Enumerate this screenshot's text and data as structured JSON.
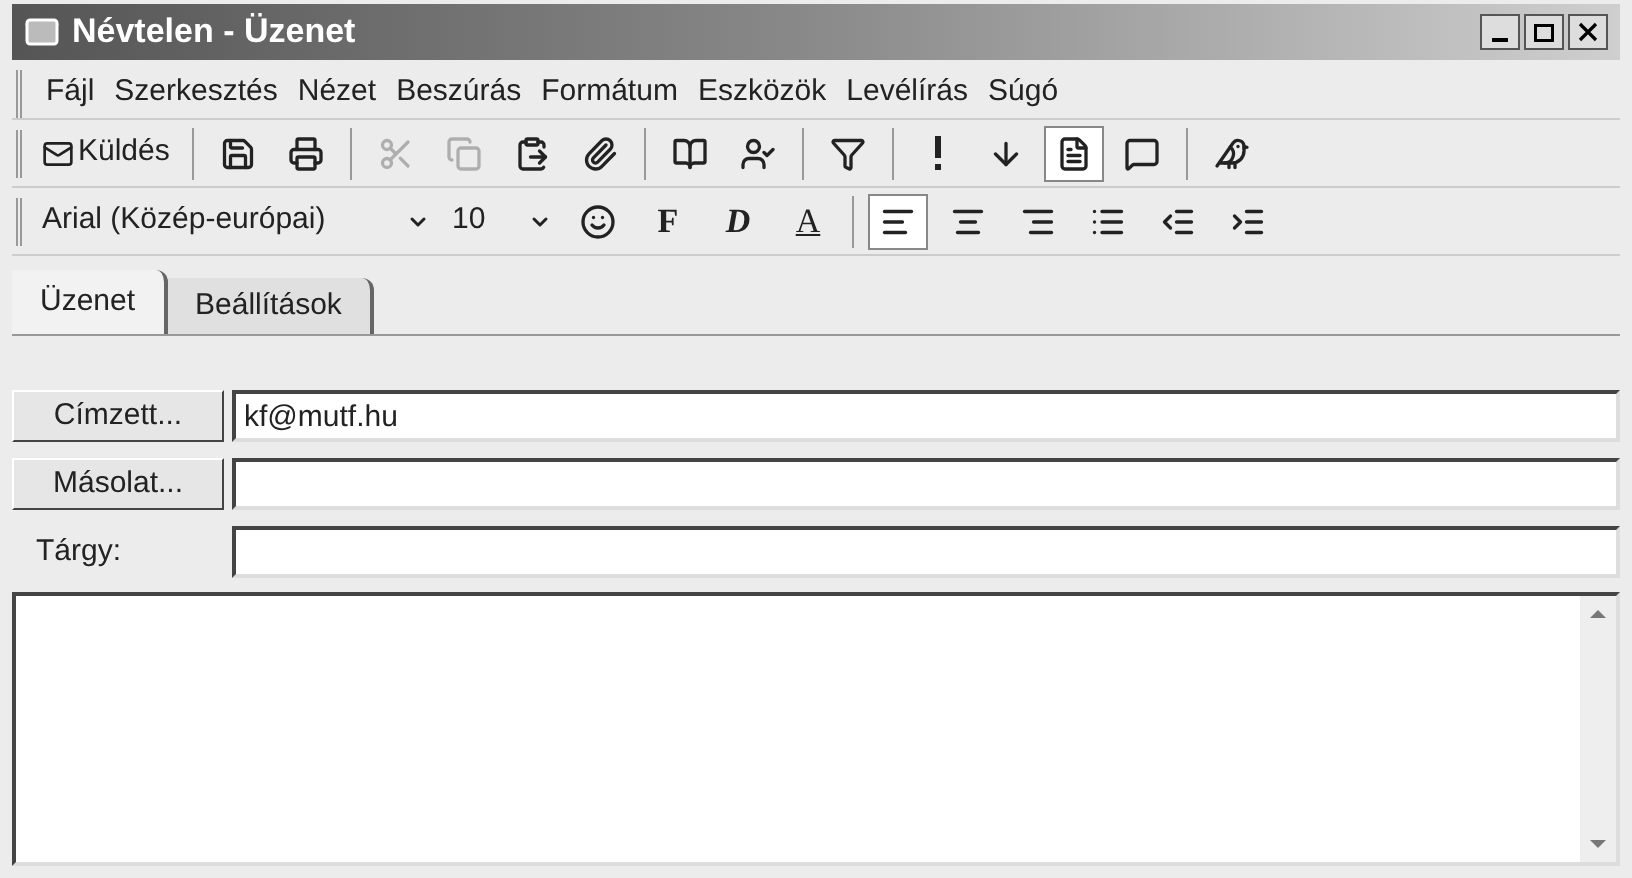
{
  "window": {
    "title": "Névtelen - Üzenet"
  },
  "menu": [
    "Fájl",
    "Szerkesztés",
    "Nézet",
    "Beszúrás",
    "Formátum",
    "Eszközök",
    "Levélírás",
    "Súgó"
  ],
  "toolbar": [
    {
      "kind": "send",
      "label": "Küldés",
      "pressed": false,
      "disabled": false
    },
    {
      "kind": "sep"
    },
    {
      "kind": "save",
      "pressed": false,
      "disabled": false
    },
    {
      "kind": "print",
      "pressed": false,
      "disabled": false
    },
    {
      "kind": "sep"
    },
    {
      "kind": "cut",
      "pressed": false,
      "disabled": true
    },
    {
      "kind": "copy",
      "pressed": false,
      "disabled": true
    },
    {
      "kind": "paste",
      "pressed": false,
      "disabled": false
    },
    {
      "kind": "attach",
      "pressed": false,
      "disabled": false
    },
    {
      "kind": "sep"
    },
    {
      "kind": "addressbook",
      "pressed": false,
      "disabled": false
    },
    {
      "kind": "checknames",
      "pressed": false,
      "disabled": false
    },
    {
      "kind": "sep"
    },
    {
      "kind": "filter",
      "pressed": false,
      "disabled": false
    },
    {
      "kind": "sep"
    },
    {
      "kind": "high",
      "pressed": false,
      "disabled": false
    },
    {
      "kind": "low",
      "pressed": false,
      "disabled": false
    },
    {
      "kind": "stationery",
      "pressed": true,
      "disabled": false
    },
    {
      "kind": "help",
      "pressed": false,
      "disabled": false
    },
    {
      "kind": "sep"
    },
    {
      "kind": "assistant",
      "pressed": false,
      "disabled": false
    }
  ],
  "format_bar": {
    "font": "Arial (Közép-európai)",
    "size": "10",
    "buttons": [
      {
        "kind": "stamp"
      },
      {
        "kind": "bold",
        "label": "F"
      },
      {
        "kind": "italic",
        "label": "D"
      },
      {
        "kind": "underline",
        "label": "A"
      },
      {
        "kind": "sep"
      },
      {
        "kind": "align-left",
        "pressed": true
      },
      {
        "kind": "align-center",
        "pressed": false
      },
      {
        "kind": "align-right",
        "pressed": false
      },
      {
        "kind": "list",
        "pressed": false
      },
      {
        "kind": "outdent",
        "pressed": false
      },
      {
        "kind": "indent",
        "pressed": false
      }
    ]
  },
  "tabs": [
    {
      "label": "Üzenet",
      "selected": true
    },
    {
      "label": "Beállítások",
      "selected": false
    }
  ],
  "fields": [
    {
      "kind": "button",
      "label": "Címzett...",
      "value": "kf@mutf.hu"
    },
    {
      "kind": "button",
      "label": "Másolat..."
    },
    {
      "kind": "label",
      "label": "Tárgy:"
    }
  ]
}
